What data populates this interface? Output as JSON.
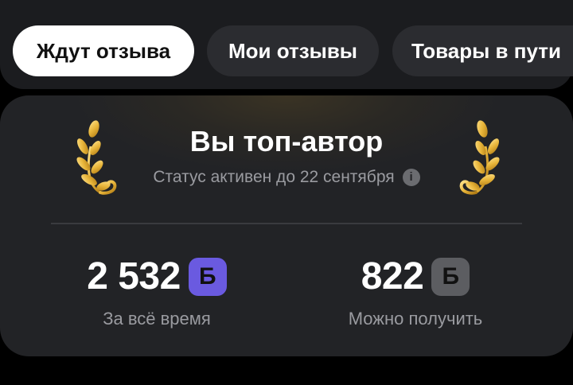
{
  "tabs": [
    {
      "label": "Ждут отзыва",
      "active": true
    },
    {
      "label": "Мои отзывы",
      "active": false
    },
    {
      "label": "Товары в пути",
      "active": false
    }
  ],
  "card": {
    "title": "Вы топ-автор",
    "status": "Статус активен до 22 сентября",
    "info_icon": "i"
  },
  "stats": [
    {
      "value": "2 532",
      "currency": "Б",
      "caption": "За всё время",
      "badge_color": "#6a5ae0"
    },
    {
      "value": "822",
      "currency": "Б",
      "caption": "Можно получить",
      "badge_color": "#5c5d61"
    }
  ],
  "colors": {
    "background": "#000000",
    "card": "#222326",
    "accent_gold": "#e8b53a",
    "badge_purple": "#6a5ae0",
    "badge_gray": "#5c5d61"
  }
}
